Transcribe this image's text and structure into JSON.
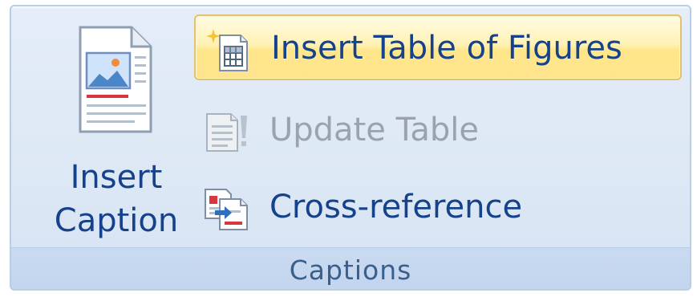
{
  "ribbon_group": {
    "label": "Captions",
    "insert_caption": {
      "line1": "Insert",
      "line2": "Caption",
      "icon": "insert-caption-icon"
    },
    "insert_table_of_figures": {
      "label": "Insert Table of Figures",
      "icon": "table-of-figures-icon",
      "state": "hover"
    },
    "update_table": {
      "label": "Update Table",
      "icon": "update-table-icon",
      "state": "disabled"
    },
    "cross_reference": {
      "label": "Cross-reference",
      "icon": "cross-reference-icon"
    }
  },
  "colors": {
    "label_text": "#15428b",
    "group_label_text": "#3b5f8c",
    "disabled_text": "#9aa3ad",
    "hover_fill": "#ffe68a",
    "hover_border": "#e3c26f",
    "group_background": "#dde8f5"
  }
}
